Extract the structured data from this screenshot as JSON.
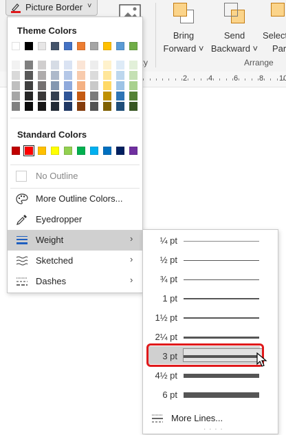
{
  "ribbon": {
    "picture_border_label": "Picture Border",
    "bring_forward": [
      "Bring",
      "Forward ˅"
    ],
    "send_backward": [
      "Send",
      "Backward ˅"
    ],
    "selection_partial": [
      "Select",
      "Par"
    ],
    "group_partial": "ity",
    "group_arrange": "Arrange",
    "ruler_numbers": [
      "2",
      "4",
      "6",
      "8",
      "10"
    ]
  },
  "menu": {
    "theme_header": "Theme Colors",
    "standard_header": "Standard Colors",
    "no_outline": "No Outline",
    "more_outline_colors": "More Outline Colors...",
    "eyedropper": "Eyedropper",
    "weight": "Weight",
    "sketched": "Sketched",
    "dashes": "Dashes"
  },
  "theme_colors": {
    "top_row": [
      "#ffffff",
      "#000000",
      "#e7e6e6",
      "#44546a",
      "#4472c4",
      "#ed7d31",
      "#a5a5a5",
      "#ffc000",
      "#5b9bd5",
      "#70ad47"
    ],
    "shade_columns": [
      [
        "#f2f2f2",
        "#d9d9d9",
        "#bfbfbf",
        "#a6a6a6",
        "#808080"
      ],
      [
        "#808080",
        "#595959",
        "#404040",
        "#262626",
        "#0d0d0d"
      ],
      [
        "#d0cece",
        "#aeabab",
        "#757171",
        "#3a3838",
        "#171616"
      ],
      [
        "#d6dce5",
        "#adb9ca",
        "#8497b0",
        "#333f50",
        "#222a35"
      ],
      [
        "#dae3f3",
        "#b4c7e7",
        "#8faadc",
        "#2f5597",
        "#203864"
      ],
      [
        "#fbe5d6",
        "#f8cbad",
        "#f4b183",
        "#c55a11",
        "#843c0c"
      ],
      [
        "#ededed",
        "#dbdbdb",
        "#c9c9c9",
        "#7b7b7b",
        "#525252"
      ],
      [
        "#fff2cc",
        "#ffe699",
        "#ffd966",
        "#bf9000",
        "#7f6000"
      ],
      [
        "#deebf7",
        "#bdd7ee",
        "#9dc3e6",
        "#2e75b6",
        "#1f4e79"
      ],
      [
        "#e2f0d9",
        "#c5e0b4",
        "#a9d18e",
        "#548235",
        "#385723"
      ]
    ]
  },
  "standard_colors": [
    "#c00000",
    "#ff0000",
    "#ffc000",
    "#ffff00",
    "#92d050",
    "#00b050",
    "#00b0f0",
    "#0070c0",
    "#002060",
    "#7030a0"
  ],
  "weights": [
    {
      "label": "¼ pt",
      "thickness": 0.5
    },
    {
      "label": "½ pt",
      "thickness": 1
    },
    {
      "label": "¾ pt",
      "thickness": 1
    },
    {
      "label": "1 pt",
      "thickness": 2
    },
    {
      "label": "1½ pt",
      "thickness": 2
    },
    {
      "label": "2¼ pt",
      "thickness": 3
    },
    {
      "label": "3 pt",
      "thickness": 4
    },
    {
      "label": "4½ pt",
      "thickness": 6
    },
    {
      "label": "6 pt",
      "thickness": 8
    }
  ],
  "selected_weight": "3 pt",
  "more_lines": "More Lines...",
  "accent_highlight": "#e0191b"
}
